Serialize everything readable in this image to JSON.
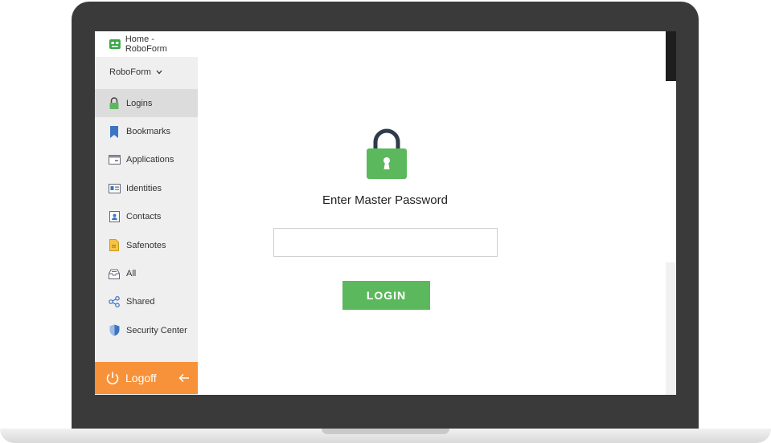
{
  "window": {
    "title": "Home - RoboForm"
  },
  "sidebar": {
    "account_selector": "RoboForm",
    "items": [
      {
        "label": "Logins",
        "icon": "lock-icon",
        "active": true
      },
      {
        "label": "Bookmarks",
        "icon": "bookmark-icon"
      },
      {
        "label": "Applications",
        "icon": "application-icon"
      },
      {
        "label": "Identities",
        "icon": "identity-icon"
      },
      {
        "label": "Contacts",
        "icon": "contact-icon"
      },
      {
        "label": "Safenotes",
        "icon": "note-icon"
      },
      {
        "label": "All",
        "icon": "inbox-icon"
      },
      {
        "label": "Shared",
        "icon": "share-icon"
      },
      {
        "label": "Security Center",
        "icon": "shield-icon"
      }
    ],
    "logoff_label": "Logoff"
  },
  "main": {
    "title": "Enter Master Password",
    "password_value": "",
    "login_label": "LOGIN"
  },
  "colors": {
    "accent_green": "#5cb85c",
    "logoff_orange": "#f7923a",
    "bookmark_blue": "#3b74c4"
  }
}
